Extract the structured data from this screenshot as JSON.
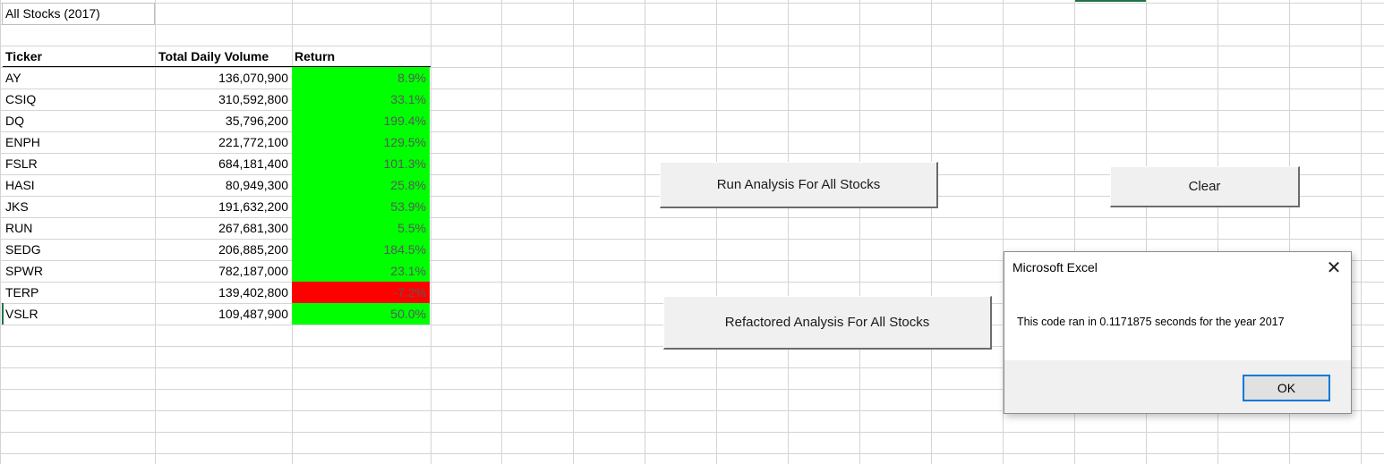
{
  "sheet_title": "All Stocks (2017)",
  "table": {
    "headers": [
      "Ticker",
      "Total Daily Volume",
      "Return"
    ],
    "rows": [
      {
        "ticker": "AY",
        "volume": "136,070,900",
        "ret": "8.9%",
        "color": "#00ff00"
      },
      {
        "ticker": "CSIQ",
        "volume": "310,592,800",
        "ret": "33.1%",
        "color": "#00ff00"
      },
      {
        "ticker": "DQ",
        "volume": "35,796,200",
        "ret": "199.4%",
        "color": "#00ff00"
      },
      {
        "ticker": "ENPH",
        "volume": "221,772,100",
        "ret": "129.5%",
        "color": "#00ff00"
      },
      {
        "ticker": "FSLR",
        "volume": "684,181,400",
        "ret": "101.3%",
        "color": "#00ff00"
      },
      {
        "ticker": "HASI",
        "volume": "80,949,300",
        "ret": "25.8%",
        "color": "#00ff00"
      },
      {
        "ticker": "JKS",
        "volume": "191,632,200",
        "ret": "53.9%",
        "color": "#00ff00"
      },
      {
        "ticker": "RUN",
        "volume": "267,681,300",
        "ret": "5.5%",
        "color": "#00ff00"
      },
      {
        "ticker": "SEDG",
        "volume": "206,885,200",
        "ret": "184.5%",
        "color": "#00ff00"
      },
      {
        "ticker": "SPWR",
        "volume": "782,187,000",
        "ret": "23.1%",
        "color": "#00ff00"
      },
      {
        "ticker": "TERP",
        "volume": "139,402,800",
        "ret": "-7.2%",
        "color": "#ff0000"
      },
      {
        "ticker": "VSLR",
        "volume": "109,487,900",
        "ret": "50.0%",
        "color": "#00ff00"
      }
    ]
  },
  "buttons": {
    "run": "Run Analysis For All Stocks",
    "clear": "Clear",
    "refactored": "Refactored Analysis For All Stocks"
  },
  "dialog": {
    "title": "Microsoft Excel",
    "message": "This code ran in 0.1171875 seconds for the year 2017",
    "ok": "OK",
    "close_icon": "close-icon"
  },
  "colors": {
    "positive": "#00ff00",
    "negative": "#ff0000",
    "gridline": "#d4d4d4",
    "dialog_accent": "#0078d7"
  }
}
